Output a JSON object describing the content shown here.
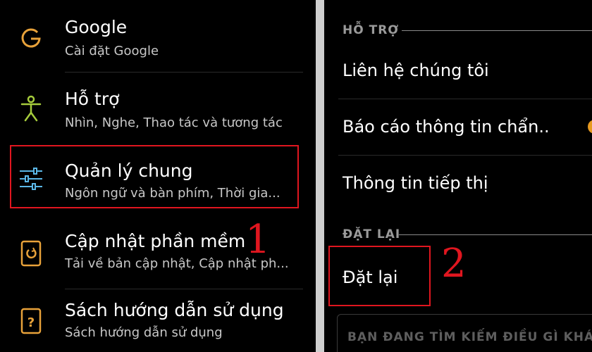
{
  "left": {
    "items": [
      {
        "title": "Google",
        "subtitle": "Cài đặt Google",
        "icon": "google-g-icon"
      },
      {
        "title": "Hỗ trợ",
        "subtitle": "Nhìn, Nghe, Thao tác và tương tác",
        "icon": "accessibility-person-icon"
      },
      {
        "title": "Quản lý chung",
        "subtitle": "Ngôn ngữ và bàn phím, Thời gia...",
        "icon": "sliders-icon"
      },
      {
        "title": "Cập nhật phần mềm",
        "subtitle": "Tải về bản cập nhật, Cập nhật ph...",
        "icon": "software-update-icon"
      },
      {
        "title": "Sách hướng dẫn sử dụng",
        "subtitle": "Sách hướng dẫn sử dụng",
        "icon": "user-manual-icon"
      }
    ],
    "step_number": "1"
  },
  "right": {
    "section_support": "HỖ TRỢ",
    "items": [
      "Liên hệ chúng tôi",
      "Báo cáo thông tin chẩn..",
      "Thông tin tiếp thị"
    ],
    "section_reset": "ĐẶT LẠI",
    "reset_label": "Đặt lại",
    "step_number": "2",
    "search_placeholder": "BẠN ĐANG TÌM KIẾM ĐIỀU GÌ KHÁC?"
  },
  "colors": {
    "highlight": "#e0161f",
    "icon_google": "#e8a23a",
    "icon_support": "#a6cc3c",
    "icon_general": "#5bb8e8",
    "icon_update": "#e8a23a",
    "icon_manual": "#e8a23a",
    "toggle_dot": "#e79a20"
  }
}
